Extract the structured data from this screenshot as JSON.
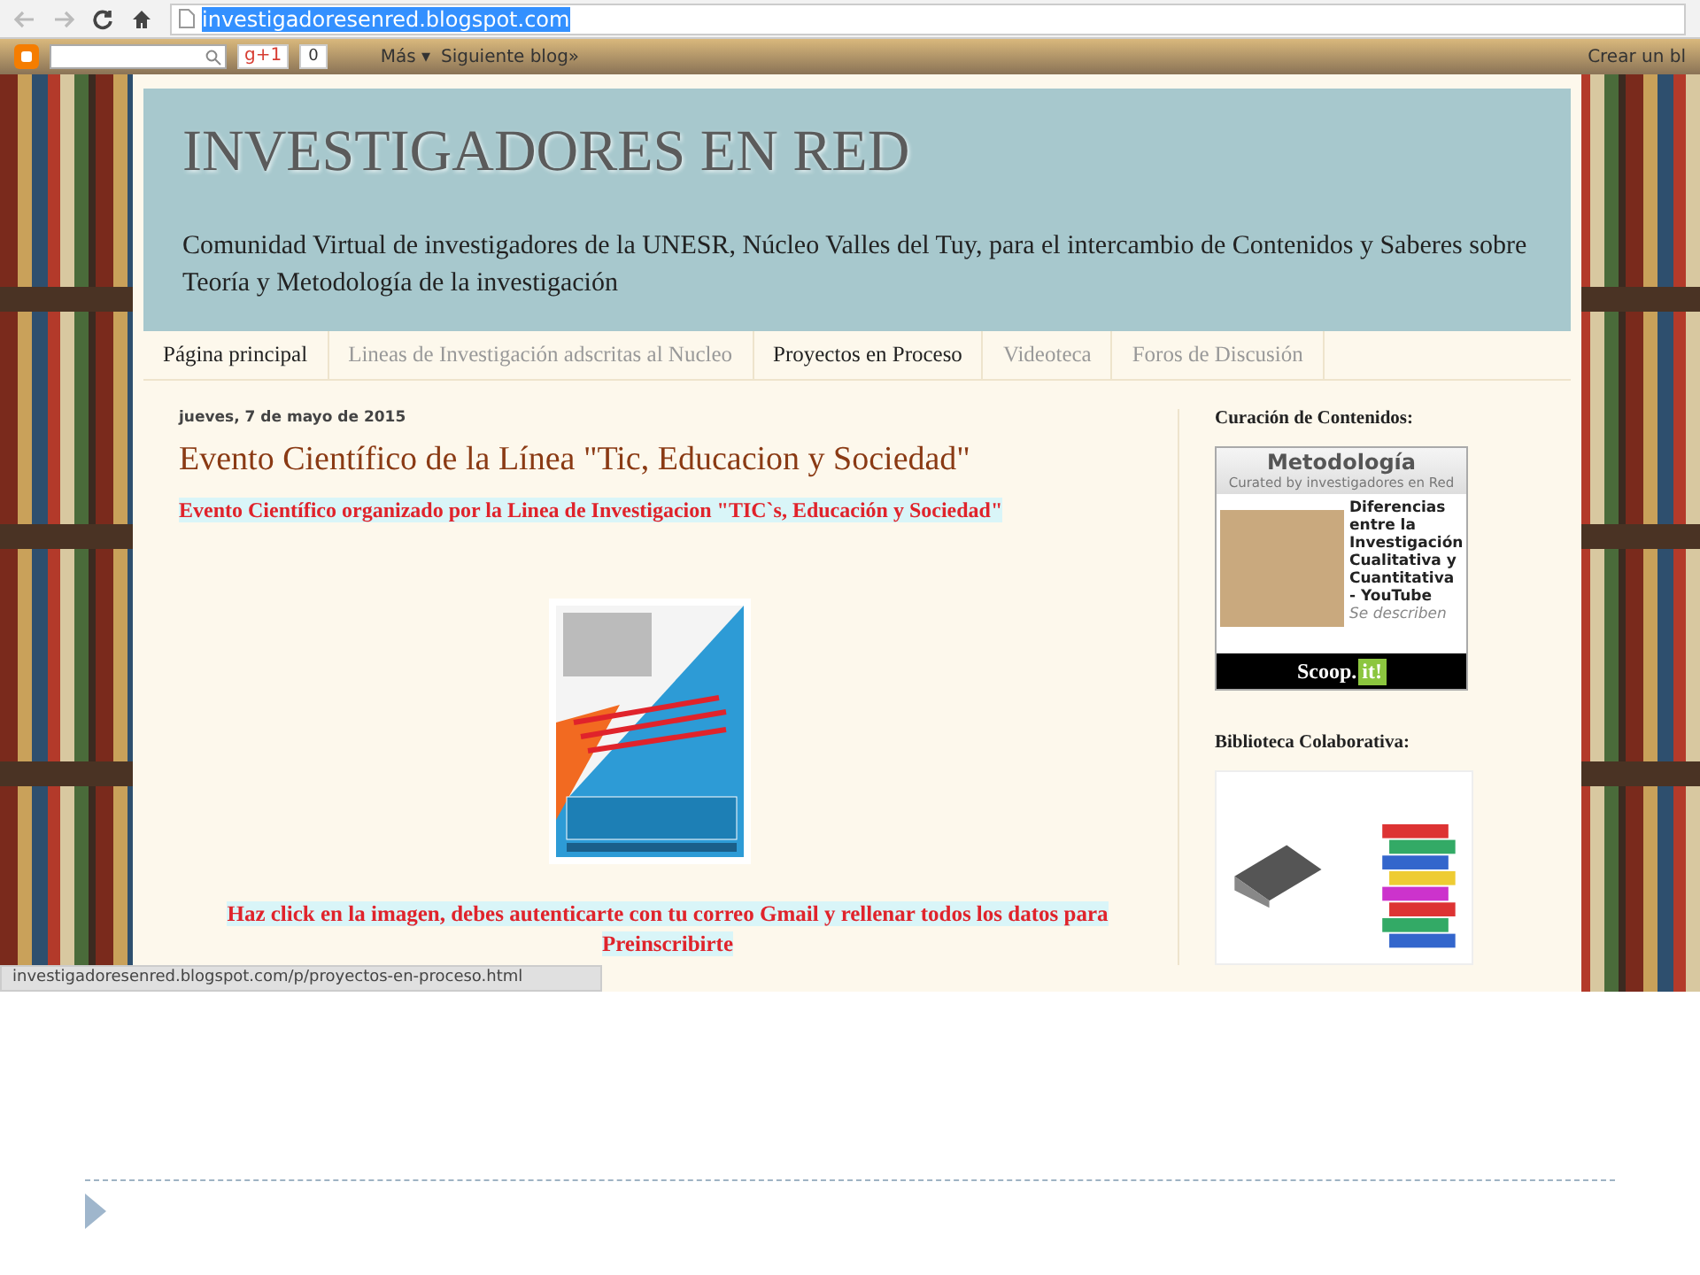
{
  "browser": {
    "url": "investigadoresenred.blogspot.com",
    "url_selected": true
  },
  "navbar": {
    "gplus": "g+1",
    "gplus_count": "0",
    "more": "Más ▾",
    "next_blog": "Siguiente blog»",
    "create": "Crear un bl"
  },
  "header": {
    "title": "INVESTIGADORES EN RED",
    "description": "Comunidad Virtual de investigadores de la UNESR, Núcleo Valles del Tuy, para el intercambio de Contenidos y Saberes sobre Teoría y Metodología de la investigación"
  },
  "tabs": [
    {
      "label": "Página principal",
      "selected": true
    },
    {
      "label": "Lineas de Investigación adscritas al Nucleo",
      "selected": false
    },
    {
      "label": "Proyectos en Proceso",
      "selected": true
    },
    {
      "label": "Videoteca",
      "selected": false
    },
    {
      "label": "Foros de Discusión",
      "selected": false
    }
  ],
  "post": {
    "date": "jueves, 7 de mayo de 2015",
    "title": "Evento Científico de la Línea \"Tic, Educacion y Sociedad\"",
    "subtitle": "Evento Científico organizado por la Linea de Investigacion \"TIC`s, Educación y Sociedad\"",
    "call_to_action": "Haz click en la imagen, debes autenticarte con tu correo Gmail y rellenar todos los datos para Preinscribirte"
  },
  "sidebar": {
    "curation_title": "Curación de Contenidos:",
    "widget": {
      "topic": "Metodología",
      "curated_by": "Curated by investigadores en Red",
      "article": "Diferencias entre la Investigación Cualitativa y Cuantitativa - YouTube",
      "excerpt": "Se describen",
      "logo_main": "Scoop.",
      "logo_accent": "it!"
    },
    "library_title": "Biblioteca Colaborativa:"
  },
  "status_bar": "investigadoresenred.blogspot.com/p/proyectos-en-proceso.html"
}
